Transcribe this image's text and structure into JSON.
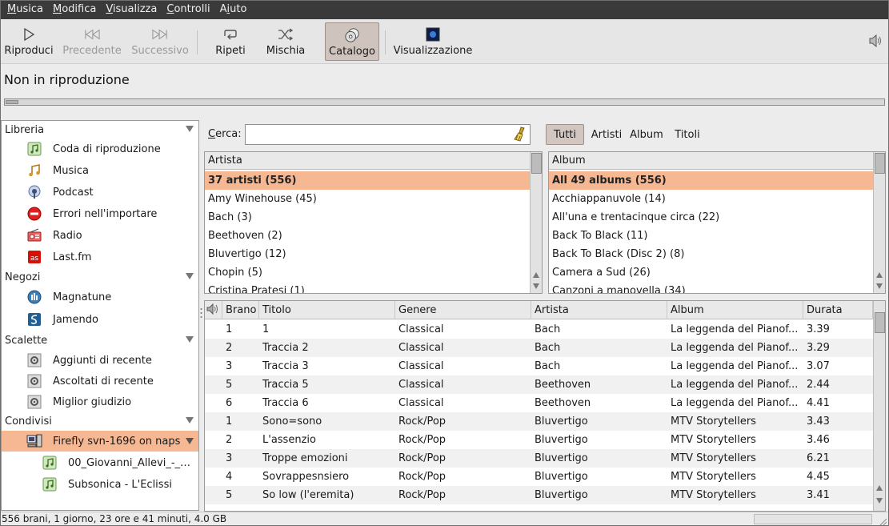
{
  "menu": [
    {
      "pre": "",
      "u": "M",
      "post": "usica"
    },
    {
      "pre": "",
      "u": "M",
      "post": "odifica"
    },
    {
      "pre": "",
      "u": "V",
      "post": "isualizza"
    },
    {
      "pre": "",
      "u": "C",
      "post": "ontrolli"
    },
    {
      "pre": "A",
      "u": "i",
      "post": "uto"
    }
  ],
  "toolbar": {
    "play": "Riproduci",
    "prev": "Precedente",
    "next": "Successivo",
    "repeat": "Ripeti",
    "shuffle": "Mischia",
    "browse": "Catalogo",
    "visual": "Visualizzazione"
  },
  "now_playing": "Non in riproduzione",
  "sidebar": {
    "sections": [
      {
        "label": "Libreria"
      },
      {
        "label": "Negozi"
      },
      {
        "label": "Scalette"
      },
      {
        "label": "Condivisi"
      }
    ],
    "items": [
      {
        "label": "Coda di riproduzione",
        "icon": "music-note-icon"
      },
      {
        "label": "Musica",
        "icon": "music-note-icon"
      },
      {
        "label": "Podcast",
        "icon": "podcast-icon"
      },
      {
        "label": "Errori nell'importare",
        "icon": "error-icon"
      },
      {
        "label": "Radio",
        "icon": "radio-icon"
      },
      {
        "label": "Last.fm",
        "icon": "lastfm-icon"
      },
      {
        "label": "Magnatune",
        "icon": "magnatune-icon"
      },
      {
        "label": "Jamendo",
        "icon": "jamendo-icon"
      },
      {
        "label": "Aggiunti di recente",
        "icon": "gear-icon"
      },
      {
        "label": "Ascoltati di recente",
        "icon": "gear-icon"
      },
      {
        "label": "Miglior giudizio",
        "icon": "gear-icon"
      },
      {
        "label": "Firefly svn-1696 on naps",
        "icon": "network-share-icon"
      },
      {
        "label": "00_Giovanni_Allevi_-_J...",
        "icon": "playlist-icon"
      },
      {
        "label": "Subsonica - L'Eclissi",
        "icon": "playlist-icon"
      }
    ]
  },
  "search": {
    "label_u": "C",
    "label_rest": "erca:",
    "value": "",
    "placeholder": ""
  },
  "filters": {
    "all": "Tutti",
    "artists": "Artisti",
    "albums": "Album",
    "titles": "Titoli"
  },
  "artist_pane": {
    "header": "Artista",
    "rows": [
      "37 artisti (556)",
      "Amy Winehouse (45)",
      "Bach (3)",
      "Beethoven (2)",
      "Bluvertigo (12)",
      "Chopin (5)",
      "Cristina Pratesi (1)"
    ]
  },
  "album_pane": {
    "header": "Album",
    "rows": [
      "All 49 albums (556)",
      "Acchiappanuvole (14)",
      "All'una e trentacinque circa (22)",
      "Back To Black (11)",
      "Back To Black (Disc 2) (8)",
      "Camera a Sud (26)",
      "Canzoni a manovella (34)"
    ]
  },
  "tracks": {
    "headers": {
      "track": "Brano",
      "title": "Titolo",
      "genre": "Genere",
      "artist": "Artista",
      "album": "Album",
      "duration": "Durata"
    },
    "rows": [
      {
        "track": "1",
        "title": "1",
        "genre": "Classical",
        "artist": "Bach",
        "album": "La leggenda del Pianof...",
        "duration": "3.39"
      },
      {
        "track": "2",
        "title": "Traccia 2",
        "genre": "Classical",
        "artist": "Bach",
        "album": "La leggenda del Pianof...",
        "duration": "3.29"
      },
      {
        "track": "3",
        "title": "Traccia 3",
        "genre": "Classical",
        "artist": "Bach",
        "album": "La leggenda del Pianof...",
        "duration": "3.07"
      },
      {
        "track": "5",
        "title": "Traccia 5",
        "genre": "Classical",
        "artist": "Beethoven",
        "album": "La leggenda del Pianof...",
        "duration": "2.44"
      },
      {
        "track": "6",
        "title": "Traccia 6",
        "genre": "Classical",
        "artist": "Beethoven",
        "album": "La leggenda del Pianof...",
        "duration": "4.41"
      },
      {
        "track": "1",
        "title": "Sono=sono",
        "genre": "Rock/Pop",
        "artist": "Bluvertigo",
        "album": "MTV Storytellers",
        "duration": "3.43"
      },
      {
        "track": "2",
        "title": "L'assenzio",
        "genre": "Rock/Pop",
        "artist": "Bluvertigo",
        "album": "MTV Storytellers",
        "duration": "3.46"
      },
      {
        "track": "3",
        "title": "Troppe emozioni",
        "genre": "Rock/Pop",
        "artist": "Bluvertigo",
        "album": "MTV Storytellers",
        "duration": "6.21"
      },
      {
        "track": "4",
        "title": "Sovrappesnsiero",
        "genre": "Rock/Pop",
        "artist": "Bluvertigo",
        "album": "MTV Storytellers",
        "duration": "4.45"
      },
      {
        "track": "5",
        "title": "So low (l'eremita)",
        "genre": "Rock/Pop",
        "artist": "Bluvertigo",
        "album": "MTV Storytellers",
        "duration": "3.41"
      }
    ]
  },
  "status": "556 brani, 1 giorno, 23 ore e 41 minuti, 4.0 GB",
  "colors": {
    "selection": "#f6b892",
    "menubar": "#3a3a3a",
    "active_button": "#cfc3bd"
  }
}
